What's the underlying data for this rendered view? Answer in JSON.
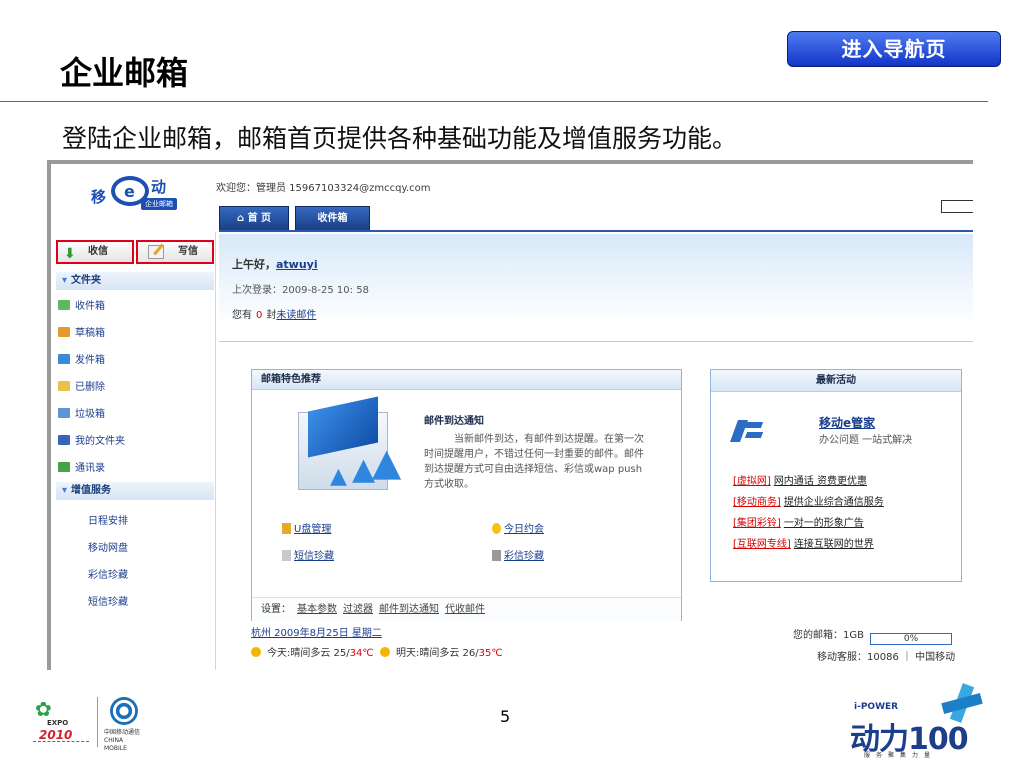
{
  "slide": {
    "title": "企业邮箱",
    "nav_button": "进入导航页",
    "subtitle": "登陆企业邮箱，邮箱首页提供各种基础功能及增值服务功能。",
    "page_number": "5"
  },
  "mail": {
    "logo": {
      "left": "移",
      "middle": "e",
      "right": "动",
      "badge": "企业邮箱"
    },
    "welcome": "欢迎您：管理员 15967103324@zmccqy.com",
    "tabs": [
      {
        "label": "⌂ 首 页"
      },
      {
        "label": "收件箱"
      }
    ],
    "sidebar": {
      "receive_label": "收信",
      "write_label": "写信",
      "folders_title": "文件夹",
      "folders": [
        {
          "label": "收件箱"
        },
        {
          "label": "草稿箱"
        },
        {
          "label": "发件箱"
        },
        {
          "label": "已删除"
        },
        {
          "label": "垃圾箱"
        },
        {
          "label": "我的文件夹"
        },
        {
          "label": "通讯录"
        }
      ],
      "vas_title": "增值服务",
      "vas_items": [
        {
          "label": "日程安排"
        },
        {
          "label": "移动网盘"
        },
        {
          "label": "彩信珍藏"
        },
        {
          "label": "短信珍藏"
        }
      ]
    },
    "greeting": {
      "prefix": "上午好，",
      "user": "atwuyi",
      "last_login": "上次登录：2009-8-25  10: 58",
      "unread_prefix": "您有",
      "unread_count": "0",
      "unread_suffix": "封",
      "unread_link": "未读邮件"
    },
    "feature": {
      "header": "邮箱特色推荐",
      "title": "邮件到达通知",
      "description": "当新邮件到达，有邮件到达提醒。在第一次时间提醒用户，不错过任何一封重要的邮件。邮件到达提醒方式可自由选择短信、彩信或wap push方式收取。",
      "links": [
        {
          "label": "U盘管理"
        },
        {
          "label": "今日约会"
        },
        {
          "label": "短信珍藏"
        },
        {
          "label": "彩信珍藏"
        }
      ],
      "settings_label": "设置：",
      "settings_links": [
        {
          "label": "基本参数"
        },
        {
          "label": "过滤器"
        },
        {
          "label": "邮件到达通知"
        },
        {
          "label": "代收邮件"
        }
      ]
    },
    "activity": {
      "header": "最新活动",
      "title": "移动e管家",
      "subtitle": "办公问题 一站式解决",
      "items": [
        {
          "tag": "[虚拟网]",
          "text": "网内通话 资费更优惠"
        },
        {
          "tag": "[移动商务]",
          "text": "提供企业综合通信服务"
        },
        {
          "tag": "[集团彩铃]",
          "text": "一对一的形象广告"
        },
        {
          "tag": "[互联网专线]",
          "text": "连接互联网的世界"
        }
      ]
    },
    "weather": {
      "date_line": "杭州 2009年8月25日 星期二",
      "today_label": "今天:晴间多云 25/",
      "today_high": "34℃",
      "tomorrow_label": "明天:晴间多云 26/",
      "tomorrow_high": "35℃"
    },
    "quota": {
      "label": "您的邮箱：1GB",
      "percent_text": "0%",
      "used_fraction": 0
    },
    "service": "移动客服：10086 ｜ 中国移动"
  },
  "footer": {
    "expo": {
      "line1": "EXPO",
      "line2": "2010"
    },
    "cm_text": "中国移动通信 CHINA MOBILE",
    "power_top": "i-POWER",
    "power_main": "动力100",
    "power_slogan": "服务聚集力量"
  },
  "colors": {
    "accent_blue": "#1235c9",
    "highlight_red": "#e0001b",
    "link_blue": "#1a3e8c"
  }
}
